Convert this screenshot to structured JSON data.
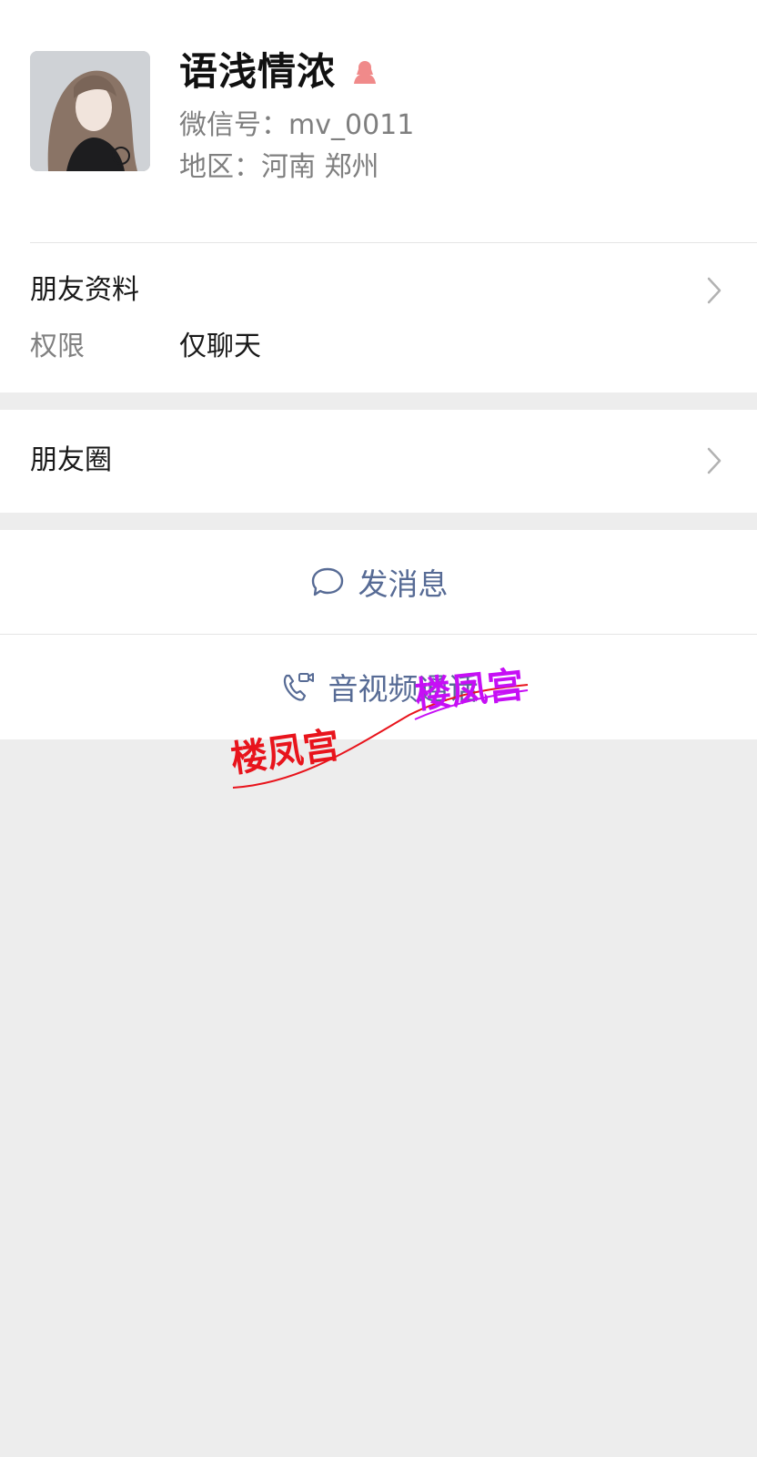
{
  "profile": {
    "name": "语浅情浓",
    "wechat_id": "微信号：mv_0011",
    "region": "地区：河南 郑州",
    "gender_icon": "female-icon"
  },
  "friend_info": {
    "title": "朋友资料",
    "permission_label": "权限",
    "permission_value": "仅聊天"
  },
  "moments": {
    "title": "朋友圈"
  },
  "actions": {
    "message_label": "发消息",
    "message_icon": "chat-bubble-icon",
    "call_label": "音视频通话",
    "call_icon": "video-call-icon"
  },
  "watermark": {
    "text_left": "楼凤宫",
    "text_right": "楼凤宫",
    "color_left": "#e8141c",
    "color_right": "#c60ff5"
  },
  "colors": {
    "accent_link": "#576b95",
    "background": "#ededed",
    "female_icon": "#f08a8a"
  }
}
